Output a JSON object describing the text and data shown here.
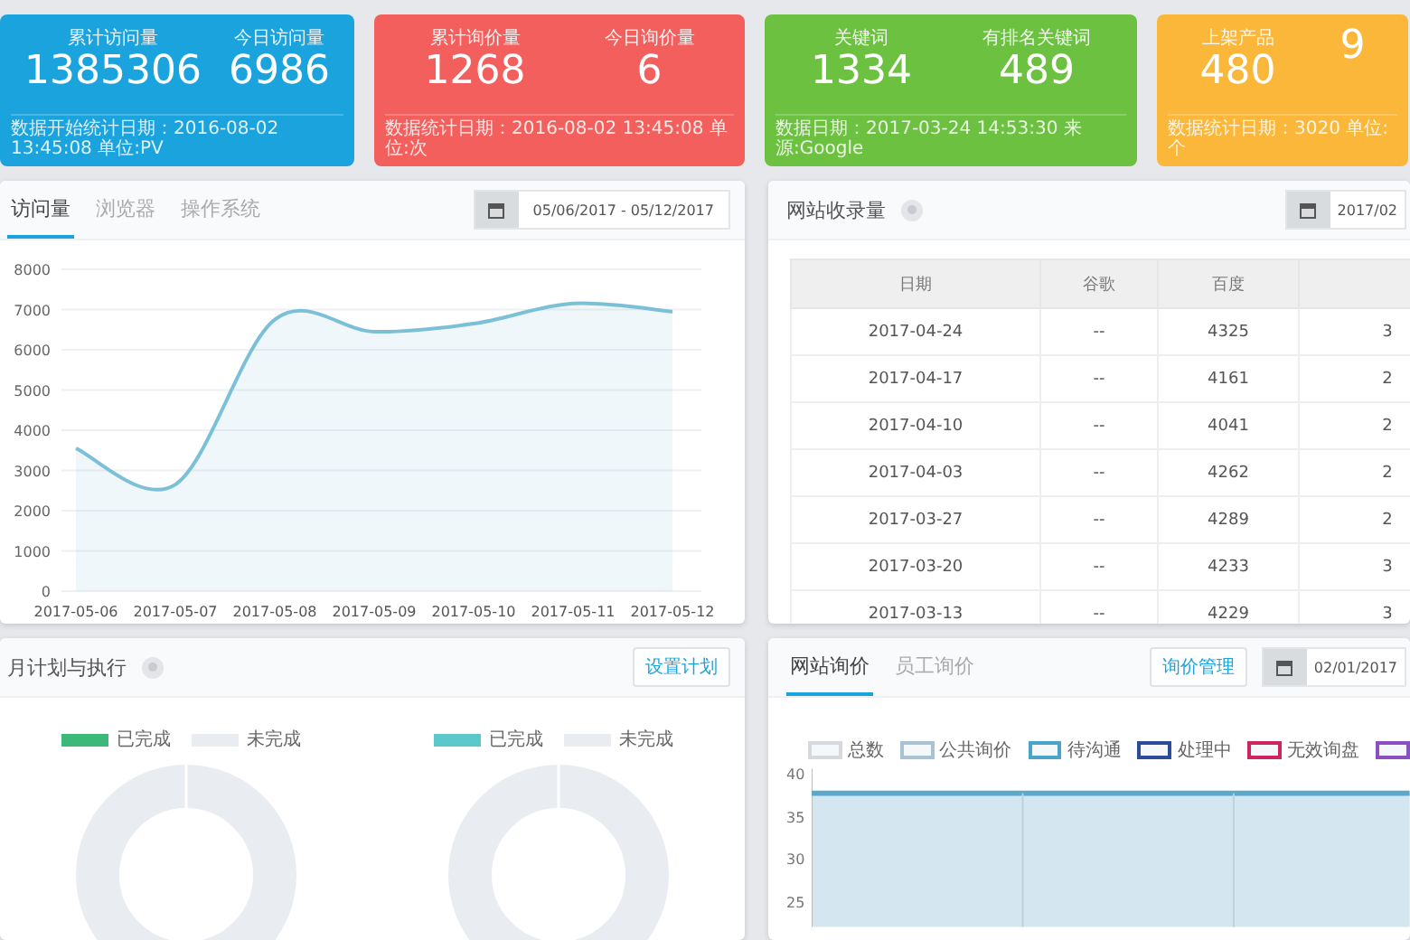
{
  "stat_cards": [
    {
      "color": "#1ba3dd",
      "metrics": [
        {
          "label": "累计访问量",
          "value": "1385306"
        },
        {
          "label": "今日访问量",
          "value": "6986"
        }
      ],
      "footer": "数据开始统计日期：2016-08-02 13:45:08 单位:PV"
    },
    {
      "color": "#f25f5c",
      "metrics": [
        {
          "label": "累计询价量",
          "value": "1268"
        },
        {
          "label": "今日询价量",
          "value": "6"
        }
      ],
      "footer": "数据统计日期：2016-08-02 13:45:08 单位:次"
    },
    {
      "color": "#6cc140",
      "metrics": [
        {
          "label": "关键词",
          "value": "1334"
        },
        {
          "label": "有排名关键词",
          "value": "489"
        }
      ],
      "footer": "数据日期：2017-03-24 14:53:30 来源:Google"
    },
    {
      "color": "#fbb73a",
      "metrics": [
        {
          "label": "上架产品",
          "value": "480"
        },
        {
          "value": "9"
        }
      ],
      "footer": "数据统计日期：3020 单位:个"
    }
  ],
  "visits_panel": {
    "tabs": [
      {
        "label": "访问量",
        "selected": true
      },
      {
        "label": "浏览器",
        "selected": false
      },
      {
        "label": "操作系统",
        "selected": false
      }
    ],
    "date_range": "05/06/2017 - 05/12/2017",
    "chart_data": {
      "type": "area",
      "categories": [
        "2017-05-06",
        "2017-05-07",
        "2017-05-08",
        "2017-05-09",
        "2017-05-10",
        "2017-05-11",
        "2017-05-12"
      ],
      "grid": true,
      "series": [
        {
          "color": "#7cc0d8",
          "values": [
            3550,
            2650,
            6750,
            6450,
            6650,
            7150,
            6950
          ]
        }
      ],
      "ylim": [
        0,
        8000
      ],
      "yticks": [
        0,
        1000,
        2000,
        3000,
        4000,
        5000,
        6000,
        7000,
        8000
      ]
    }
  },
  "index_panel": {
    "title": "网站收录量",
    "date_range": "2017/02",
    "table": {
      "columns": [
        "日期",
        "谷歌",
        "百度"
      ],
      "rows": [
        [
          "2017-04-24",
          "--",
          "4325",
          "3"
        ],
        [
          "2017-04-17",
          "--",
          "4161",
          "2"
        ],
        [
          "2017-04-10",
          "--",
          "4041",
          "2"
        ],
        [
          "2017-04-03",
          "--",
          "4262",
          "2"
        ],
        [
          "2017-03-27",
          "--",
          "4289",
          "2"
        ],
        [
          "2017-03-20",
          "--",
          "4233",
          "3"
        ],
        [
          "2017-03-13",
          "--",
          "4229",
          "3"
        ]
      ]
    }
  },
  "plan_panel": {
    "title": "月计划与执行",
    "button": "设置计划",
    "donuts": [
      {
        "legend": [
          {
            "label": "已完成",
            "color": "#3cb878"
          },
          {
            "label": "未完成",
            "color": "#e9ecf0"
          }
        ]
      },
      {
        "legend": [
          {
            "label": "已完成",
            "color": "#5cc8cc"
          },
          {
            "label": "未完成",
            "color": "#e9ecf0"
          }
        ]
      }
    ]
  },
  "inquiry_panel": {
    "tabs": [
      {
        "label": "网站询价",
        "selected": true
      },
      {
        "label": "员工询价",
        "selected": false
      }
    ],
    "button": "询价管理",
    "date_range": "02/01/2017",
    "legend": [
      {
        "label": "总数",
        "color": "#d5d9dd"
      },
      {
        "label": "公共询价",
        "color": "#a9c3d2"
      },
      {
        "label": "待沟通",
        "color": "#4aa3c8"
      },
      {
        "label": "处理中",
        "color": "#2c4b9a"
      },
      {
        "label": "无效询盘",
        "color": "#d0245e"
      },
      {
        "color": "#8a4fc0"
      }
    ],
    "y_ticks": [
      "40",
      "35",
      "30",
      "25"
    ]
  }
}
